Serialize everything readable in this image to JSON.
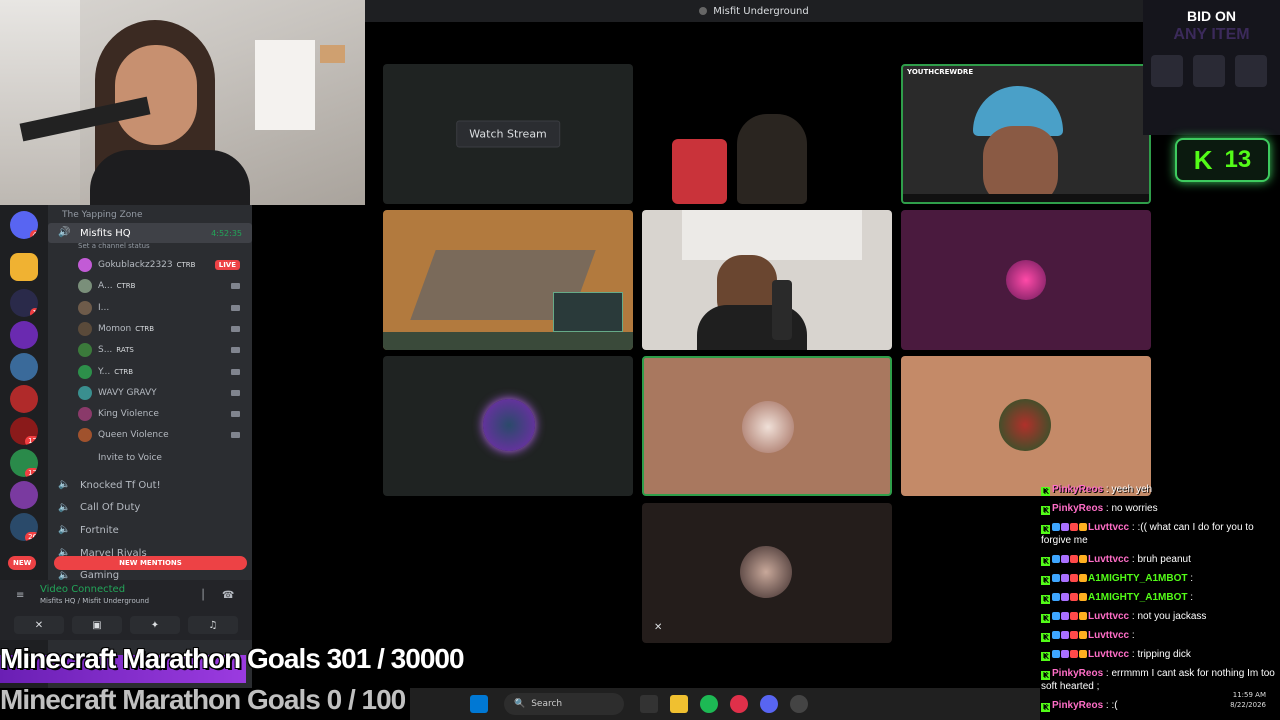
{
  "window": {
    "title": "Misfit Underground"
  },
  "stage": {
    "watch_stream_label": "Watch Stream",
    "participants": [
      {
        "label": "YOUTHCREWDRE"
      }
    ]
  },
  "sidebar": {
    "category": "The Yapping Zone",
    "channel": {
      "name": "Misfits HQ",
      "status": "Set a channel status",
      "timer": "4:52:35"
    },
    "members": [
      {
        "name": "Gokublackz2323",
        "tag": "CTRB",
        "live": "LIVE",
        "color": "#c25bd6"
      },
      {
        "name": "A...",
        "tag": "CTRB",
        "color": "#7a8f7a"
      },
      {
        "name": "I...",
        "tag": "",
        "color": "#6e5b4a"
      },
      {
        "name": "Momon",
        "tag": "CTRB",
        "color": "#5a4a3a"
      },
      {
        "name": "S...",
        "tag": "RATS",
        "color": "#3b7a3b"
      },
      {
        "name": "Y...",
        "tag": "CTRB",
        "color": "#2d8f4a"
      },
      {
        "name": "WAVY GRAVY",
        "tag": "",
        "color": "#3a8f8f"
      },
      {
        "name": "King Violence",
        "tag": "",
        "color": "#8a3a6a"
      },
      {
        "name": "Queen Violence",
        "tag": "",
        "color": "#a0522d"
      }
    ],
    "invite": "Invite to Voice",
    "voice_channels": [
      {
        "name": "Knocked Tf Out!"
      },
      {
        "name": "Call Of Duty"
      },
      {
        "name": "Fortnite"
      },
      {
        "name": "Marvel Rivals"
      },
      {
        "name": "Gaming"
      }
    ],
    "new_label": "NEW",
    "mentions_label": "NEW MENTIONS",
    "badges": [
      "4",
      "1",
      "12",
      "17",
      "26"
    ]
  },
  "voice_panel": {
    "status": "Video Connected",
    "location": "Misfits HQ / Misfit Underground"
  },
  "overlay": {
    "goal_1": "Minecraft Marathon Goals 301 / 30000",
    "goal_2": "Minecraft Marathon Goals 0 / 100"
  },
  "taskbar": {
    "search_placeholder": "Search"
  },
  "ad": {
    "title": "BID ON",
    "subtitle": "ANY ITEM"
  },
  "kick": {
    "count": "13"
  },
  "chat": [
    {
      "user": "PinkyReos",
      "color": "#ff6ec7",
      "msg": "yeeh yeh",
      "badges": 0
    },
    {
      "user": "PinkyReos",
      "color": "#ff6ec7",
      "msg": "no worries",
      "badges": 0
    },
    {
      "user": "Luvttvcc",
      "color": "#ff6ec7",
      "msg": ":(( what can I do for you to forgive me",
      "badges": 4
    },
    {
      "user": "Luvttvcc",
      "color": "#ff6ec7",
      "msg": "bruh peanut",
      "badges": 4
    },
    {
      "user": "A1MIGHTY_A1MBOT",
      "color": "#53fc18",
      "msg": "",
      "badges": 4
    },
    {
      "user": "A1MIGHTY_A1MBOT",
      "color": "#53fc18",
      "msg": "",
      "badges": 4
    },
    {
      "user": "Luvttvcc",
      "color": "#ff6ec7",
      "msg": "not you jackass",
      "badges": 4
    },
    {
      "user": "Luvttvcc",
      "color": "#ff6ec7",
      "msg": "",
      "badges": 4
    },
    {
      "user": "Luvttvcc",
      "color": "#ff6ec7",
      "msg": "tripping dick",
      "badges": 4
    },
    {
      "user": "PinkyReos",
      "color": "#ff6ec7",
      "msg": "errmmm I cant ask for nothing Im too soft hearted ;",
      "badges": 0
    },
    {
      "user": "PinkyReos",
      "color": "#ff6ec7",
      "msg": ":(",
      "badges": 0
    }
  ],
  "tray": {
    "time": "11:59 AM",
    "date": "8/22/2026"
  }
}
